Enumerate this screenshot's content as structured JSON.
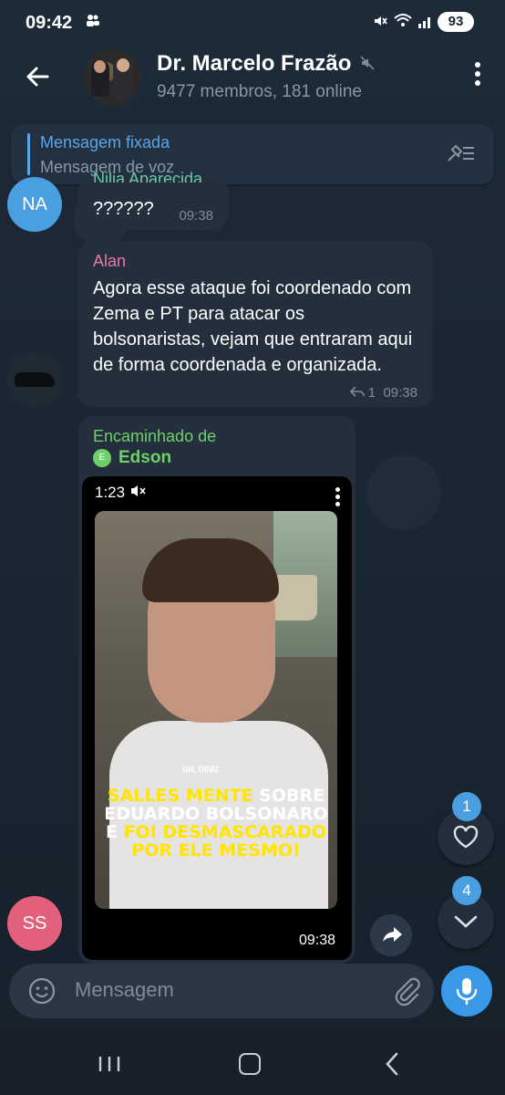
{
  "status_bar": {
    "time": "09:42",
    "battery": "93"
  },
  "header": {
    "title": "Dr. Marcelo Frazão",
    "subtitle": "9477 membros, 181 online"
  },
  "pinned": {
    "title": "Mensagem fixada",
    "text": "Mensagem de voz"
  },
  "messages": [
    {
      "avatar_initials": "NA",
      "sender_partial": "Nilia Aparecida",
      "text": "??????",
      "time": "09:38"
    },
    {
      "sender": "Alan",
      "text": "Agora esse ataque foi coordenado com Zema e PT para atacar os bolsonaristas, vejam que entraram aqui de forma coordenada e organizada.",
      "replies": "1",
      "time": "09:38"
    },
    {
      "avatar_initials": "SS",
      "forwarded_label": "Encaminhado de",
      "forwarded_from": "Edson",
      "forwarded_initial": "E",
      "video": {
        "duration": "1:23",
        "logo": "GIL DINIZ",
        "caption_line1_yellow": "SALLES MENTE",
        "caption_line1_white": " SOBRE",
        "caption_line2": "EDUARDO BOLSONARO",
        "caption_line3_white": "E ",
        "caption_line3_yellow": "FOI DESMASCARADO",
        "caption_line4": "POR ELE MESMO!",
        "time": "09:38"
      }
    }
  ],
  "badges": {
    "reactions": "1",
    "unread": "4"
  },
  "input": {
    "placeholder": "Mensagem"
  },
  "colors": {
    "accent": "#4a9fe0",
    "bubble": "#242f3d",
    "background": "#1b2634"
  }
}
